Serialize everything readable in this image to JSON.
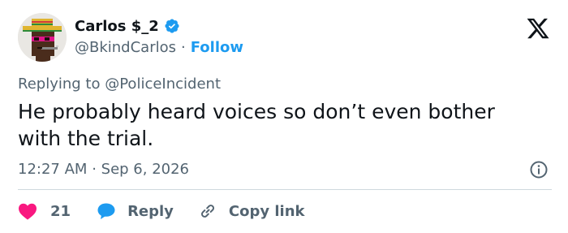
{
  "author": {
    "display_name": "Carlos $_2",
    "handle": "@BkindCarlos",
    "separator": "·",
    "follow_label": "Follow"
  },
  "reply": {
    "prefix": "Replying to",
    "target": "@PoliceIncident"
  },
  "tweet": {
    "text": "He probably heard voices so don’t even bother with the trial.",
    "time": "12:27 AM",
    "separator": "·",
    "date": "Sep 6, 2026"
  },
  "actions": {
    "like_count": "21",
    "reply_label": "Reply",
    "copy_link_label": "Copy link"
  },
  "icons": {
    "verified": "verified-badge-icon",
    "brand": "x-logo-icon",
    "info": "info-icon",
    "like": "heart-icon",
    "reply": "speech-bubble-icon",
    "copy": "link-icon"
  },
  "colors": {
    "accent": "#1d9bf0",
    "text_primary": "#0f1419",
    "text_secondary": "#536471",
    "like": "#f91880",
    "divider": "#cfd9de"
  }
}
